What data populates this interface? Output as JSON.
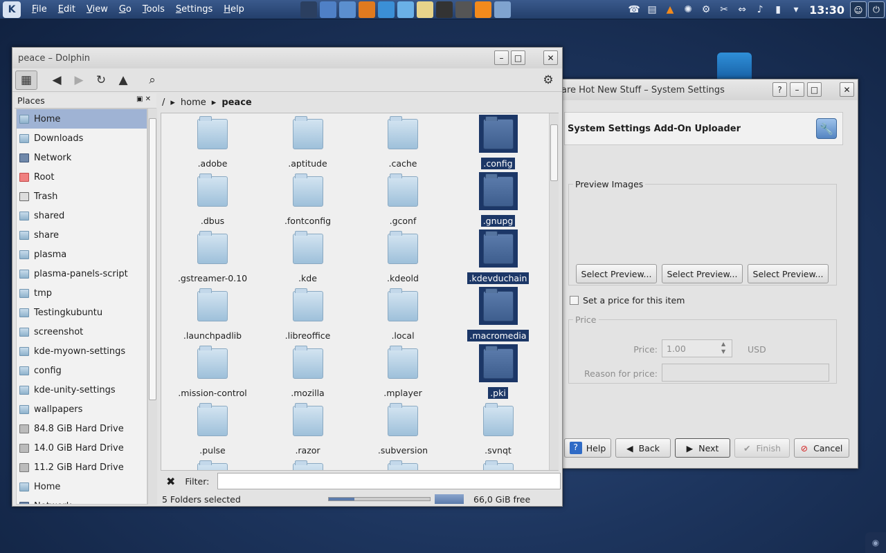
{
  "panel": {
    "logo": "K",
    "menus": [
      "File",
      "Edit",
      "View",
      "Go",
      "Tools",
      "Settings",
      "Help"
    ],
    "launchers": [
      {
        "name": "files-icon",
        "color": "#2b3f60"
      },
      {
        "name": "bookmark-icon",
        "color": "#4f80c6"
      },
      {
        "name": "kde-app-icon",
        "color": "#5b8fcf"
      },
      {
        "name": "firefox-icon",
        "color": "#e07a1f"
      },
      {
        "name": "kdevelop-icon",
        "color": "#3b8fd6"
      },
      {
        "name": "dolphin-icon",
        "color": "#6ab0e6"
      },
      {
        "name": "notes-icon",
        "color": "#e7d38a"
      },
      {
        "name": "terminal-icon",
        "color": "#333333"
      },
      {
        "name": "camera-icon",
        "color": "#555555"
      },
      {
        "name": "vlc-icon",
        "color": "#f28a1c"
      },
      {
        "name": "settings-app-icon",
        "color": "#7fa3cf"
      }
    ],
    "clock": "13:30"
  },
  "dolphin": {
    "title": "peace – Dolphin",
    "places_title": "Places",
    "places": [
      {
        "label": "Home",
        "icon": "home-icon",
        "selected": true
      },
      {
        "label": "Downloads",
        "icon": "folder-icon"
      },
      {
        "label": "Network",
        "icon": "network-icon"
      },
      {
        "label": "Root",
        "icon": "root-icon"
      },
      {
        "label": "Trash",
        "icon": "trash-icon"
      },
      {
        "label": "shared",
        "icon": "folder-icon"
      },
      {
        "label": "share",
        "icon": "folder-icon"
      },
      {
        "label": "plasma",
        "icon": "folder-icon"
      },
      {
        "label": "plasma-panels-script",
        "icon": "folder-icon"
      },
      {
        "label": "tmp",
        "icon": "folder-icon"
      },
      {
        "label": "Testingkubuntu",
        "icon": "folder-icon"
      },
      {
        "label": "screenshot",
        "icon": "folder-icon"
      },
      {
        "label": "kde-myown-settings",
        "icon": "folder-icon"
      },
      {
        "label": "config",
        "icon": "folder-icon"
      },
      {
        "label": "kde-unity-settings",
        "icon": "folder-icon"
      },
      {
        "label": "wallpapers",
        "icon": "folder-icon"
      },
      {
        "label": "84.8 GiB Hard Drive",
        "icon": "drive-icon"
      },
      {
        "label": "14.0 GiB Hard Drive",
        "icon": "drive-icon"
      },
      {
        "label": "11.2 GiB Hard Drive",
        "icon": "drive-icon"
      },
      {
        "label": "Home",
        "icon": "home-icon"
      },
      {
        "label": "Network",
        "icon": "network-icon"
      }
    ],
    "breadcrumb": [
      "/",
      "home",
      "peace"
    ],
    "files": [
      {
        "name": ".adobe",
        "selected": false
      },
      {
        "name": ".aptitude",
        "selected": false
      },
      {
        "name": ".cache",
        "selected": false
      },
      {
        "name": ".config",
        "selected": true
      },
      {
        "name": ".dbus",
        "selected": false
      },
      {
        "name": ".fontconfig",
        "selected": false
      },
      {
        "name": ".gconf",
        "selected": false
      },
      {
        "name": ".gnupg",
        "selected": true
      },
      {
        "name": ".gstreamer-0.10",
        "selected": false
      },
      {
        "name": ".kde",
        "selected": false
      },
      {
        "name": ".kdeold",
        "selected": false
      },
      {
        "name": ".kdevduchain",
        "selected": true
      },
      {
        "name": ".launchpadlib",
        "selected": false
      },
      {
        "name": ".libreoffice",
        "selected": false
      },
      {
        "name": ".local",
        "selected": false
      },
      {
        "name": ".macromedia",
        "selected": true
      },
      {
        "name": ".mission-control",
        "selected": false
      },
      {
        "name": ".mozilla",
        "selected": false
      },
      {
        "name": ".mplayer",
        "selected": false
      },
      {
        "name": ".pki",
        "selected": true
      },
      {
        "name": ".pulse",
        "selected": false
      },
      {
        "name": ".razor",
        "selected": false
      },
      {
        "name": ".subversion",
        "selected": false
      },
      {
        "name": ".svnqt",
        "selected": false
      }
    ],
    "filter_label": "Filter:",
    "filter_value": "",
    "status": "5 Folders selected",
    "zoom_level": 0.25,
    "free_space": "66,0 GiB free"
  },
  "settings": {
    "title": "are Hot New Stuff – System Settings",
    "header": "System Settings Add-On Uploader",
    "preview_group": "Preview Images",
    "preview_buttons": [
      "Select Preview...",
      "Select Preview...",
      "Select Preview..."
    ],
    "price_check": "Set a price for this item",
    "price_group": "Price",
    "price_label": "Price:",
    "price_value": "1.00",
    "currency": "USD",
    "reason_label": "Reason for price:",
    "reason_value": "",
    "buttons": {
      "help": "Help",
      "back": "Back",
      "next": "Next",
      "finish": "Finish",
      "cancel": "Cancel"
    }
  }
}
